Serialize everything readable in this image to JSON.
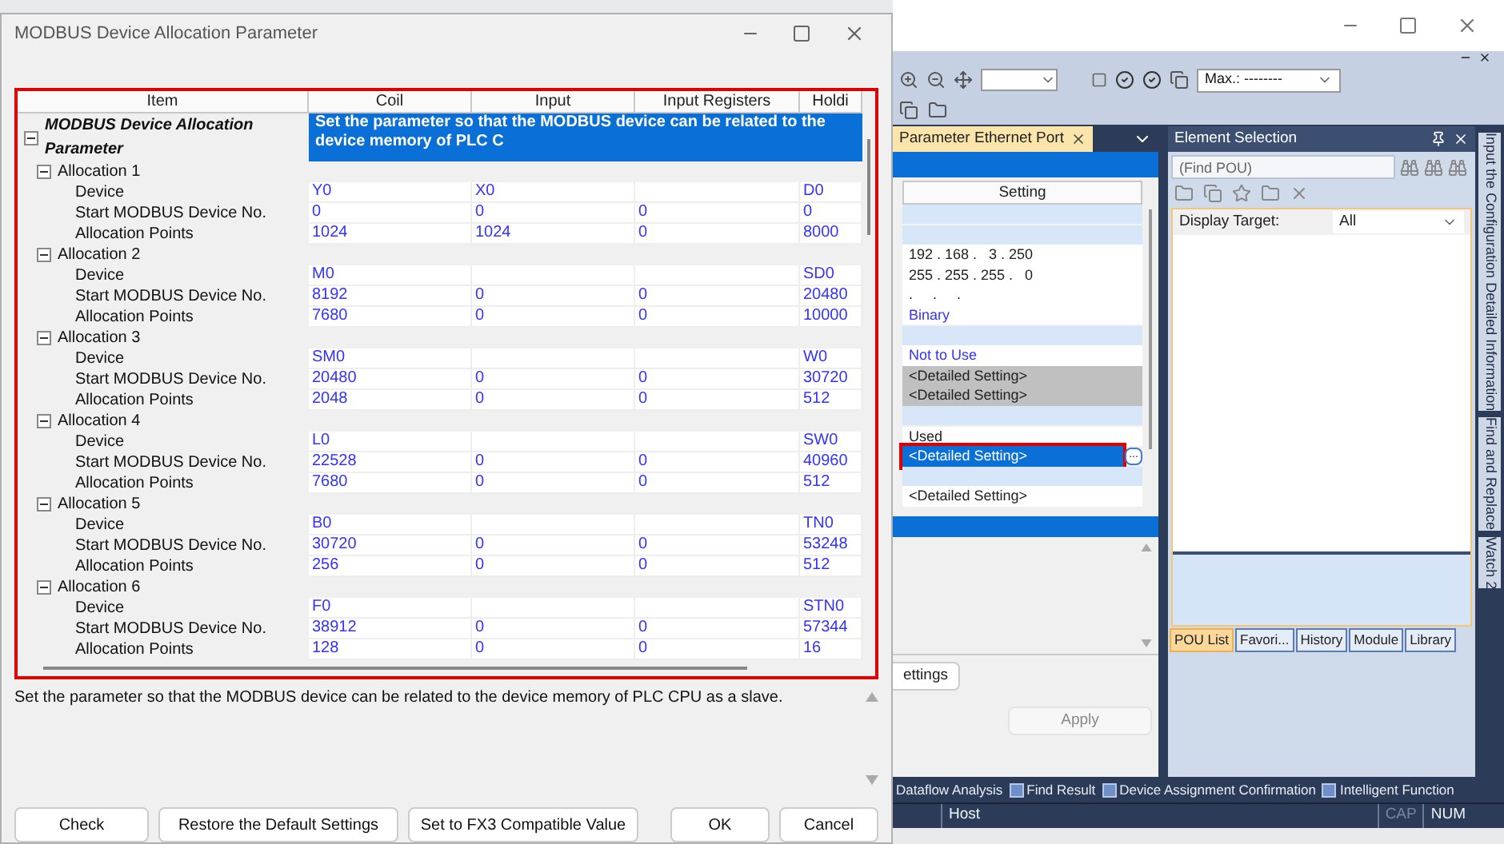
{
  "dialog": {
    "title": "MODBUS Device Allocation Parameter",
    "table": {
      "columns": [
        "Item",
        "Coil",
        "Input",
        "Input Registers",
        "Holdi"
      ],
      "root": {
        "label": "MODBUS Device Allocation Parameter",
        "description": "Set the parameter so that the MODBUS device can be related to the device memory of PLC C",
        "expanded": true,
        "selected": true
      },
      "groups": [
        {
          "label": "Allocation 1",
          "expanded": true,
          "rows": [
            {
              "label": "Device",
              "values": {
                "coil": "Y0",
                "input": "X0",
                "holding": "D0"
              }
            },
            {
              "label": "Start MODBUS Device No.",
              "values": [
                "0",
                "0",
                "0",
                "0"
              ]
            },
            {
              "label": "Allocation Points",
              "values": [
                "1024",
                "1024",
                "0",
                "8000"
              ]
            }
          ]
        },
        {
          "label": "Allocation 2",
          "expanded": true,
          "rows": [
            {
              "label": "Device",
              "values": {
                "coil": "M0",
                "holding": "SD0"
              }
            },
            {
              "label": "Start MODBUS Device No.",
              "values": [
                "8192",
                "0",
                "0",
                "20480"
              ]
            },
            {
              "label": "Allocation Points",
              "values": [
                "7680",
                "0",
                "0",
                "10000"
              ]
            }
          ]
        },
        {
          "label": "Allocation 3",
          "expanded": true,
          "rows": [
            {
              "label": "Device",
              "values": {
                "coil": "SM0",
                "holding": "W0"
              }
            },
            {
              "label": "Start MODBUS Device No.",
              "values": [
                "20480",
                "0",
                "0",
                "30720"
              ]
            },
            {
              "label": "Allocation Points",
              "values": [
                "2048",
                "0",
                "0",
                "512"
              ]
            }
          ]
        },
        {
          "label": "Allocation 4",
          "expanded": true,
          "rows": [
            {
              "label": "Device",
              "values": {
                "coil": "L0",
                "holding": "SW0"
              }
            },
            {
              "label": "Start MODBUS Device No.",
              "values": [
                "22528",
                "0",
                "0",
                "40960"
              ]
            },
            {
              "label": "Allocation Points",
              "values": [
                "7680",
                "0",
                "0",
                "512"
              ]
            }
          ]
        },
        {
          "label": "Allocation 5",
          "expanded": true,
          "rows": [
            {
              "label": "Device",
              "values": {
                "coil": "B0",
                "holding": "TN0"
              }
            },
            {
              "label": "Start MODBUS Device No.",
              "values": [
                "30720",
                "0",
                "0",
                "53248"
              ]
            },
            {
              "label": "Allocation Points",
              "values": [
                "256",
                "0",
                "0",
                "512"
              ]
            }
          ]
        },
        {
          "label": "Allocation 6",
          "expanded": true,
          "rows": [
            {
              "label": "Device",
              "values": {
                "coil": "F0",
                "holding": "STN0"
              }
            },
            {
              "label": "Start MODBUS Device No.",
              "values": [
                "38912",
                "0",
                "0",
                "57344"
              ]
            },
            {
              "label": "Allocation Points",
              "values": [
                "128",
                "0",
                "0",
                "16"
              ]
            }
          ]
        }
      ]
    },
    "description": "Set the parameter so that the MODBUS device can be related to the device memory of PLC CPU as a slave.",
    "buttons": [
      {
        "label": "Check"
      },
      {
        "label": "Restore the Default Settings"
      },
      {
        "label": "Set to FX3 Compatible Value"
      },
      {
        "label": "OK"
      },
      {
        "label": "Cancel"
      }
    ]
  },
  "app": {
    "toolbar": {
      "monitor_combo": "Max.: --------"
    },
    "parameter_panel": {
      "tab": "Parameter Ethernet Port",
      "column": "Setting",
      "rows": [
        {
          "kind": "section",
          "selected": false
        },
        {
          "kind": "section",
          "selected": false
        },
        {
          "kind": "value",
          "text": "192 . 168 .   3 . 250",
          "selected": false
        },
        {
          "kind": "value",
          "text": "255 . 255 . 255 .   0",
          "selected": false
        },
        {
          "kind": "value",
          "text": ".     .     .",
          "selected": false
        },
        {
          "kind": "setting",
          "text": "Binary",
          "selected": false
        },
        {
          "kind": "section",
          "selected": false
        },
        {
          "kind": "setting",
          "text": "Not to Use",
          "selected": false
        },
        {
          "kind": "disabled",
          "text": "<Detailed Setting>",
          "selected": false
        },
        {
          "kind": "disabled",
          "text": "<Detailed Setting>",
          "selected": false
        },
        {
          "kind": "section",
          "selected": false
        },
        {
          "kind": "value",
          "text": "Used",
          "selected": false
        },
        {
          "kind": "value",
          "text": "<Detailed Setting>",
          "selected": true,
          "button": "..."
        },
        {
          "kind": "section",
          "selected": false
        },
        {
          "kind": "value",
          "text": "<Detailed Setting>",
          "selected": false
        }
      ],
      "buttons": [
        {
          "label": "ettings",
          "disabled": false
        },
        {
          "label": "Apply",
          "disabled": true
        }
      ]
    },
    "element_selection": {
      "title": "Element Selection",
      "search": {
        "placeholder": "(Find POU)"
      },
      "display_target": {
        "label": "Display Target:",
        "value": "All"
      },
      "tabs": [
        {
          "label": "POU List",
          "selected": true
        },
        {
          "label": "Favori...",
          "selected": false
        },
        {
          "label": "History",
          "selected": false
        },
        {
          "label": "Module",
          "selected": false
        },
        {
          "label": "Library",
          "selected": false
        }
      ]
    },
    "side_tabs": [
      "Input the Configuration Detailed Information",
      "Find and Replace",
      "Watch 2"
    ],
    "bottom_tabs": [
      "Dataflow Analysis",
      "Find Result",
      "Device Assignment Confirmation",
      "Intelligent Function"
    ],
    "status_bar": [
      {
        "text": "Host",
        "disabled": false
      },
      {
        "text": "CAP",
        "disabled": true
      },
      {
        "text": "NUM",
        "disabled": false
      }
    ]
  }
}
